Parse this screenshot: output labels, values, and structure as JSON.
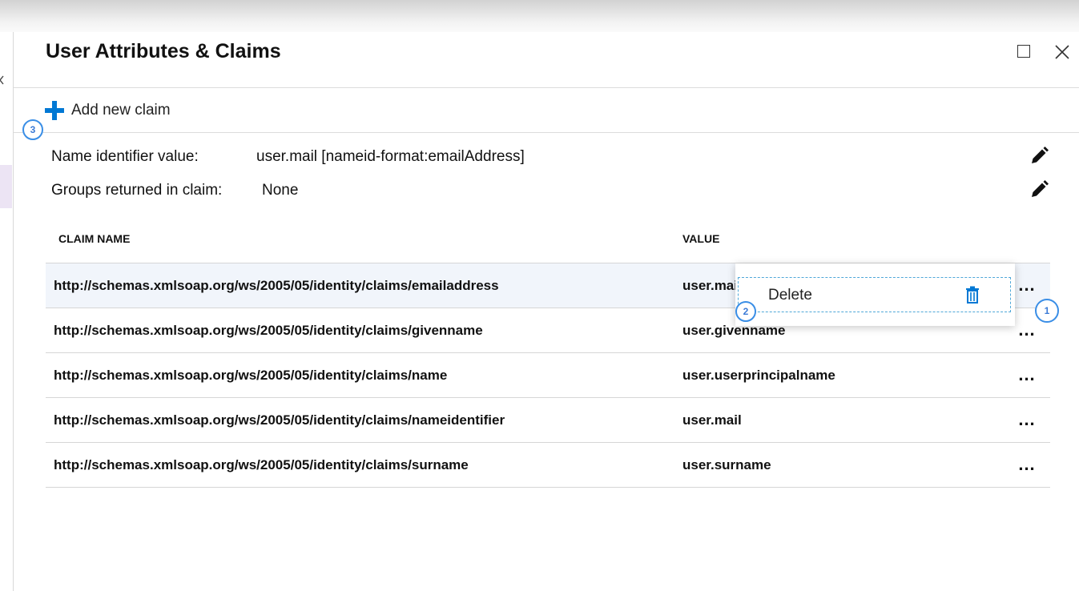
{
  "panel": {
    "title": "User Attributes & Claims"
  },
  "toolbar": {
    "add_claim_label": "Add new claim"
  },
  "identifier": {
    "name_label": "Name identifier value:",
    "name_value": "user.mail [nameid-format:emailAddress]",
    "groups_label": "Groups returned in claim:",
    "groups_value": "None"
  },
  "table": {
    "columns": [
      "CLAIM NAME",
      "VALUE"
    ],
    "rows": [
      {
        "name": "http://schemas.xmlsoap.org/ws/2005/05/identity/claims/emailaddress",
        "value": "user.mail"
      },
      {
        "name": "http://schemas.xmlsoap.org/ws/2005/05/identity/claims/givenname",
        "value": "user.givenname"
      },
      {
        "name": "http://schemas.xmlsoap.org/ws/2005/05/identity/claims/name",
        "value": "user.userprincipalname"
      },
      {
        "name": "http://schemas.xmlsoap.org/ws/2005/05/identity/claims/nameidentifier",
        "value": "user.mail"
      },
      {
        "name": "http://schemas.xmlsoap.org/ws/2005/05/identity/claims/surname",
        "value": "user.surname"
      }
    ],
    "more_label": "..."
  },
  "context_menu": {
    "delete_label": "Delete"
  },
  "callouts": [
    "1",
    "2",
    "3"
  ],
  "colors": {
    "accent": "#0078d4",
    "callout": "#3a8ee6",
    "selected_row": "#f1f5fb"
  },
  "icons": {
    "add": "plus-icon",
    "edit": "pencil-icon",
    "delete": "trash-icon",
    "maximize": "maximize-icon",
    "close": "close-icon",
    "more": "more-icon"
  }
}
